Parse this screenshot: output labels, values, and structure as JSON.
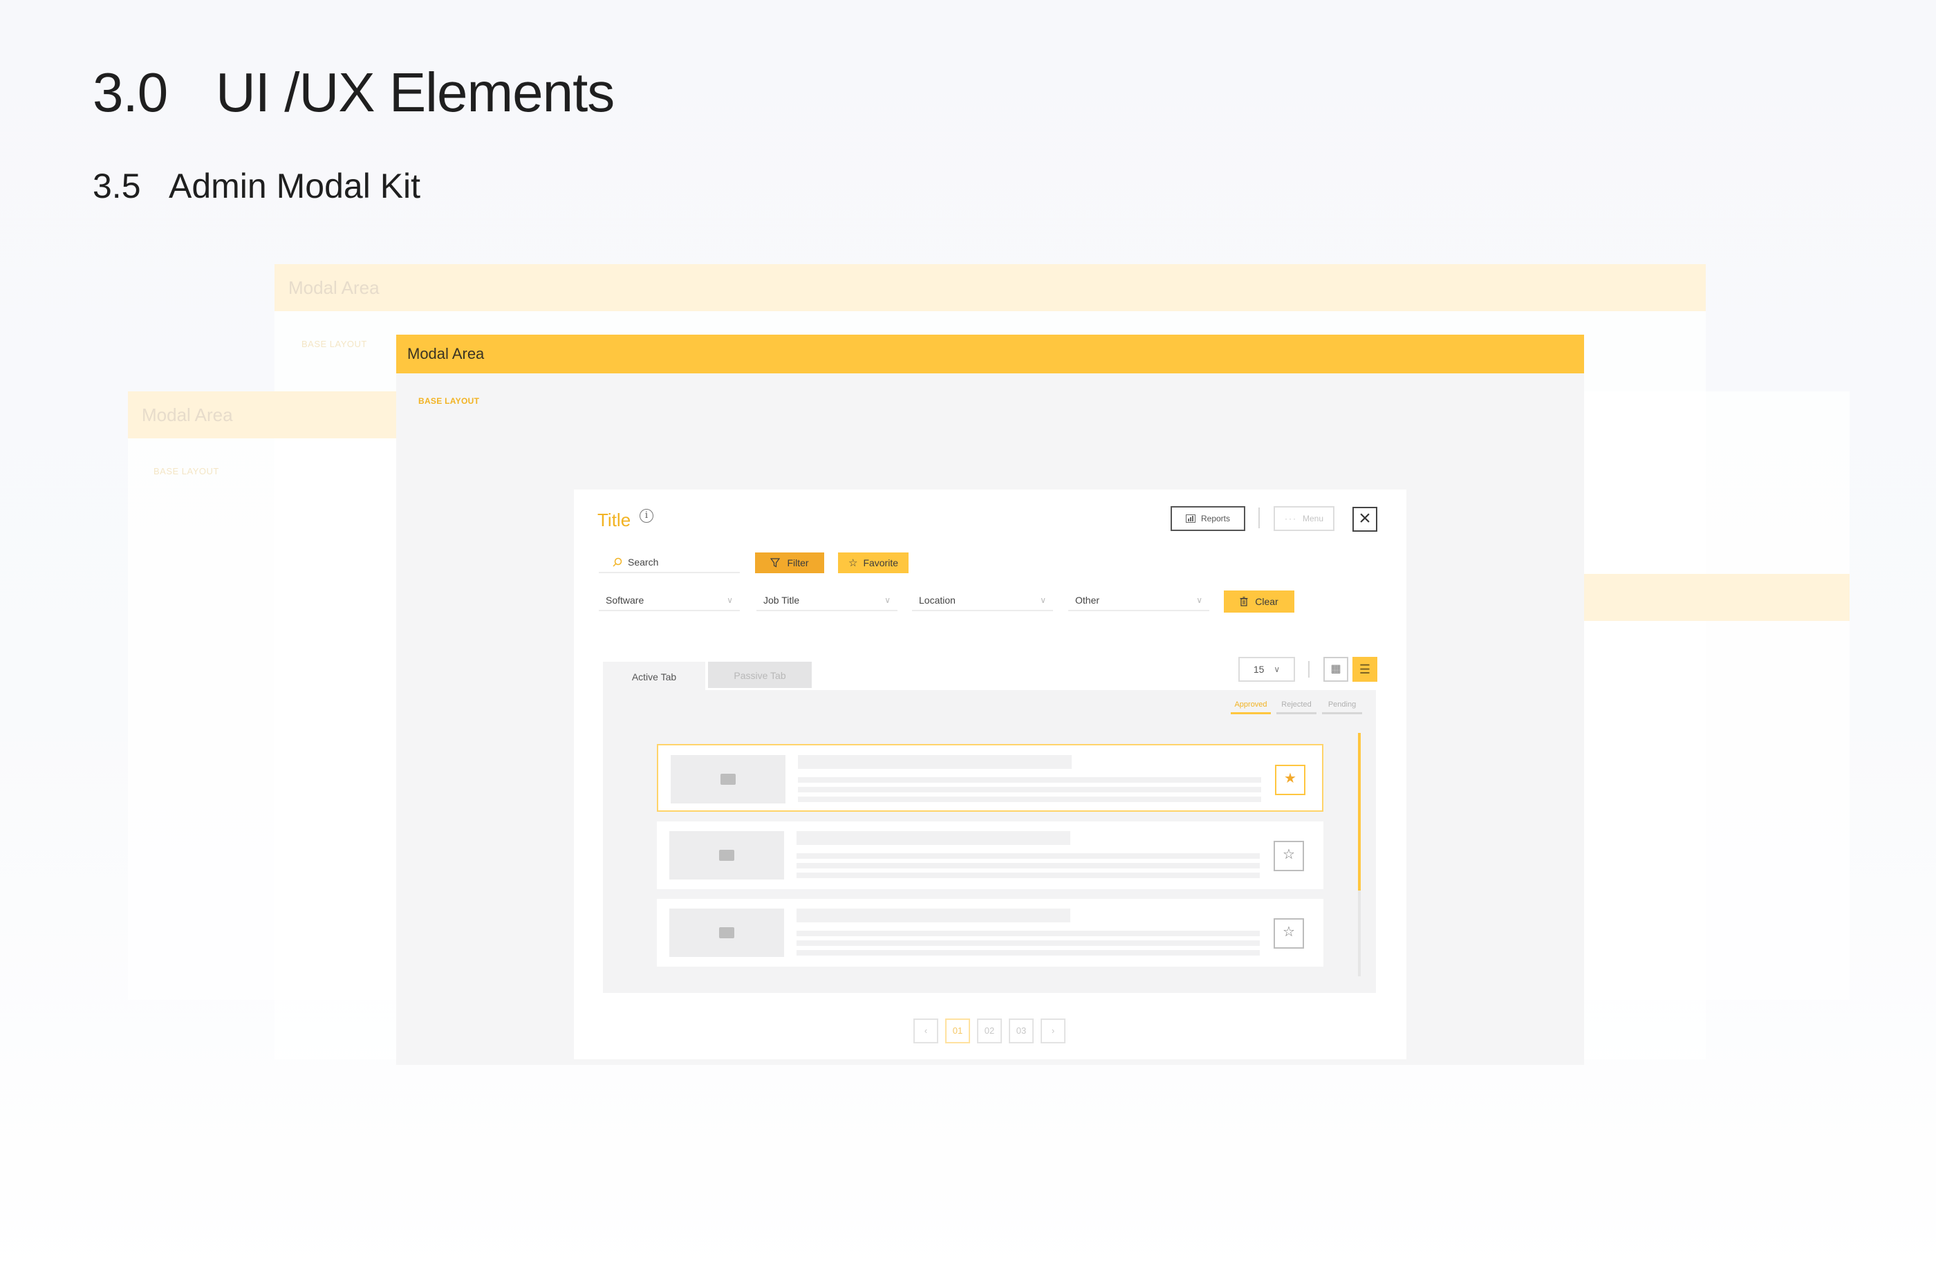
{
  "heading": {
    "section_number": "3.0",
    "section_title": "UI /UX Elements"
  },
  "subheading": {
    "section_number": "3.5",
    "section_title": "Admin Modal Kit"
  },
  "ghost_modals": [
    {
      "header": "Modal Area",
      "base_label": "BASE LAYOUT"
    },
    {
      "header": "Modal Area",
      "base_label": "BASE LAYOUT"
    }
  ],
  "main_modal": {
    "header": "Modal Area",
    "base_label": "BASE LAYOUT"
  },
  "inner_modal": {
    "title": "Title",
    "info_icon": "i",
    "toolbar": {
      "reports_label": "Reports",
      "menu_label": "Menu",
      "close_icon": "×"
    },
    "search_label": "Search",
    "filter_label": "Filter",
    "favorite_label": "Favorite",
    "dropdowns": [
      "Software",
      "Job Title",
      "Location",
      "Other"
    ],
    "clear_label": "Clear",
    "tabs": {
      "active": "Active Tab",
      "passive": "Passive Tab"
    },
    "per_page": "15",
    "status_filters": [
      "Approved",
      "Rejected",
      "Pending"
    ],
    "list_items": [
      {
        "favorited": true,
        "star": "★"
      },
      {
        "favorited": false,
        "star": "☆"
      },
      {
        "favorited": false,
        "star": "☆"
      }
    ],
    "pagination": {
      "prev": "‹",
      "pages": [
        "01",
        "02",
        "03"
      ],
      "next": "›",
      "current": "01"
    }
  },
  "colors": {
    "accent": "#ffc63f",
    "accent_dark": "#f2a92b",
    "title_text": "#f2b323",
    "ghost_header": "#fff3da"
  }
}
